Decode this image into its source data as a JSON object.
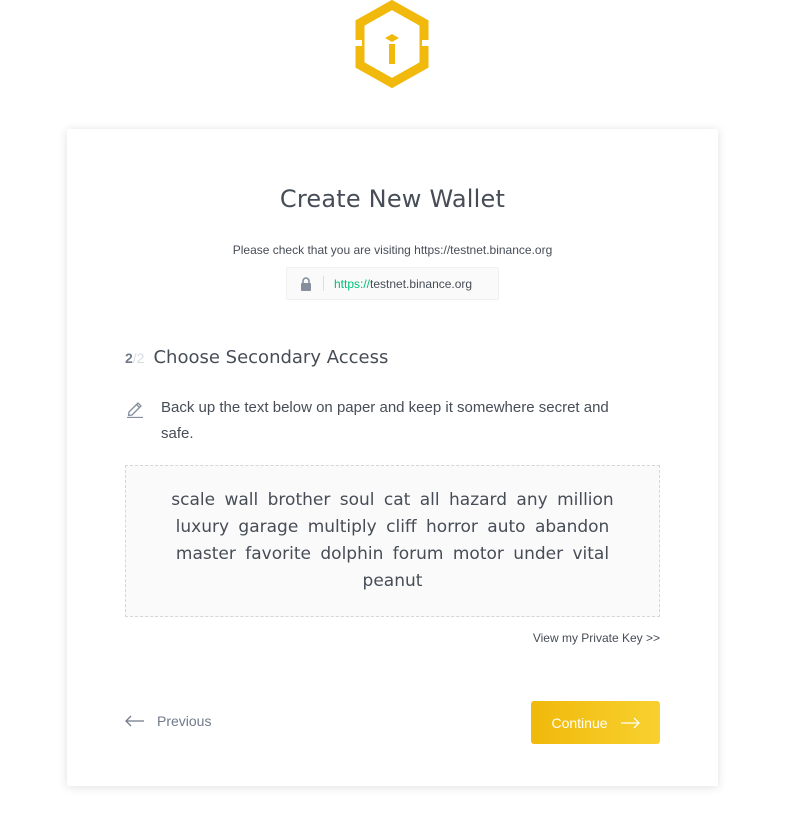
{
  "logo": {
    "icon": "binance-chain-logo",
    "color": "#f0b90b"
  },
  "card": {
    "title": "Create New Wallet",
    "notice": "Please check that you are visiting https://testnet.binance.org",
    "url_bar": {
      "icon": "lock-icon",
      "protocol": "https://",
      "domain": "testnet.binance.org"
    },
    "step": {
      "current": "2",
      "total": "/2",
      "title": "Choose Secondary Access"
    },
    "backup": {
      "icon": "pen-icon",
      "text": "Back up the text below on paper and keep it somewhere secret and safe."
    },
    "mnemonic": "scale wall brother soul cat all hazard any million luxury garage multiply cliff horror auto abandon master favorite dolphin forum motor under vital peanut",
    "private_key_link": "View my Private Key >>",
    "previous_label": "Previous",
    "continue_label": "Continue"
  },
  "colors": {
    "accent": "#f0b90b",
    "accent_light": "#f8d12f",
    "url_protocol": "#02c076",
    "text": "#474d57"
  }
}
